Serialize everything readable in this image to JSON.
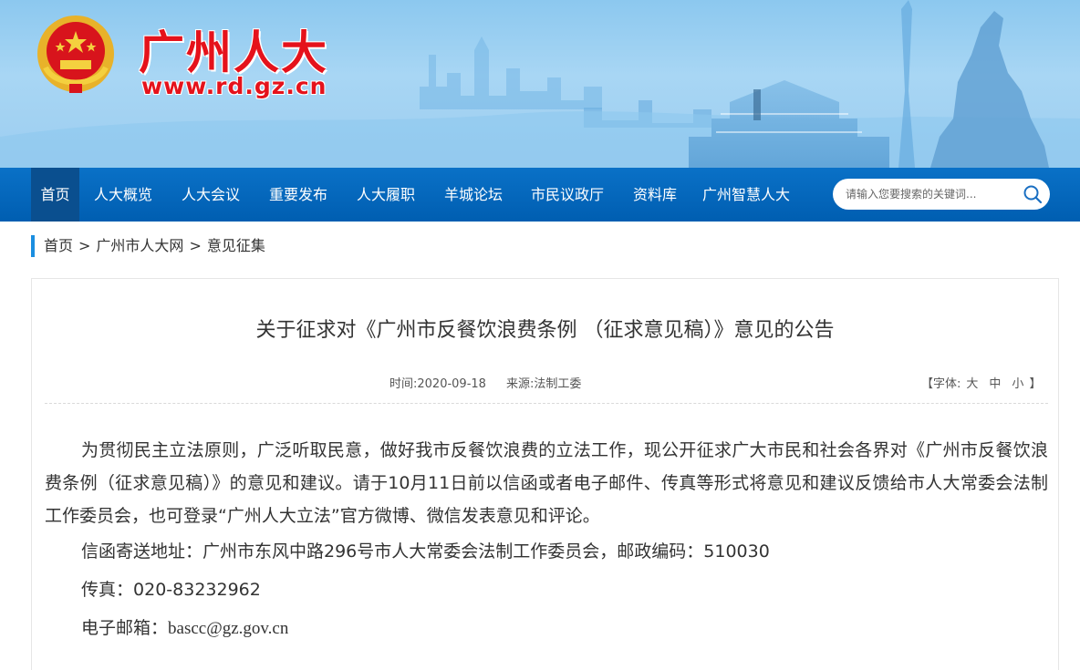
{
  "header": {
    "site_name": "广州人大",
    "site_url": "www.rd.gz.cn"
  },
  "nav": {
    "items": [
      {
        "label": "首页",
        "active": true
      },
      {
        "label": "人大概览"
      },
      {
        "label": "人大会议"
      },
      {
        "label": "重要发布"
      },
      {
        "label": "人大履职"
      },
      {
        "label": "羊城论坛"
      },
      {
        "label": "市民议政厅"
      },
      {
        "label": "资料库"
      },
      {
        "label": "广州智慧人大"
      }
    ],
    "search_placeholder": "请输入您要搜索的关键词...",
    "search_icon": "search-icon"
  },
  "breadcrumb": {
    "items": [
      "首页",
      "广州市人大网",
      "意见征集"
    ],
    "separator": ">"
  },
  "article": {
    "title": "关于征求对《广州市反餐饮浪费条例 （征求意见稿）》意见的公告",
    "time": "时间:2020-09-18",
    "source": "来源:法制工委",
    "font_label_open": "【字体:",
    "font_large": "大",
    "font_medium": "中",
    "font_small": "小",
    "font_label_close": "】",
    "paragraph": "为贯彻民主立法原则，广泛听取民意，做好我市反餐饮浪费的立法工作，现公开征求广大市民和社会各界对《广州市反餐饮浪费条例（征求意见稿）》的意见和建议。请于10月11日前以信函或者电子邮件、传真等形式将意见和建议反馈给市人大常委会法制工作委员会，也可登录“广州人大立法”官方微博、微信发表意见和评论。",
    "address": "信函寄送地址：广州市东风中路296号市人大常委会法制工作委员会，邮政编码：510030",
    "fax_label": "传真：",
    "fax": "020-83232962",
    "email_label": "电子邮箱：",
    "email": "bascc@gz.gov.cn"
  },
  "colors": {
    "nav_bg": "#005eb1",
    "nav_active": "#0a4f8f",
    "brand_red": "#e5121b",
    "breadcrumb_accent": "#1a8ee0"
  }
}
